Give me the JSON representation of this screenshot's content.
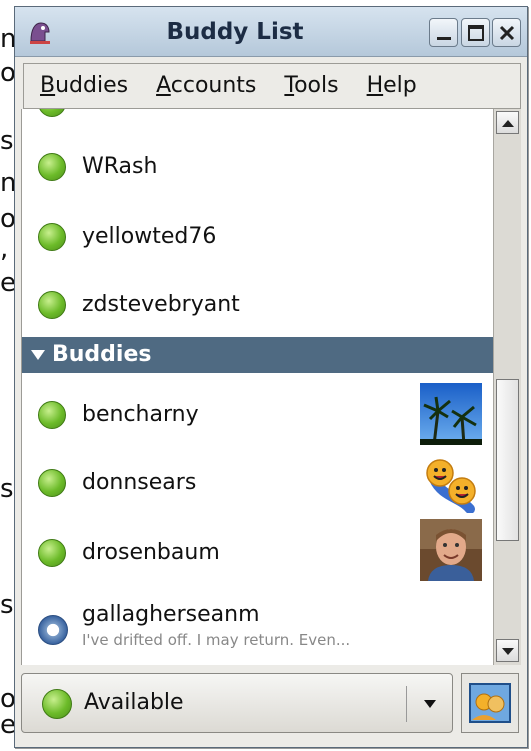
{
  "background_fragments": [
    "n",
    "o",
    "s",
    "n",
    "o",
    ",",
    "e",
    "s",
    "s",
    "o",
    "e"
  ],
  "window": {
    "title": "Buddy List"
  },
  "menu": [
    {
      "key": "B",
      "rest": "uddies"
    },
    {
      "key": "A",
      "rest": "ccounts"
    },
    {
      "key": "T",
      "rest": "ools"
    },
    {
      "key": "H",
      "rest": "elp"
    }
  ],
  "buddies_top": [
    {
      "name": "WRash",
      "status": "available"
    },
    {
      "name": "yellowted76",
      "status": "available"
    },
    {
      "name": "zdstevebryant",
      "status": "available"
    }
  ],
  "group": {
    "label": "Buddies"
  },
  "buddies_group": [
    {
      "name": "bencharny",
      "status": "available",
      "avatar": "palm-trees-avatar"
    },
    {
      "name": "donnsears",
      "status": "available",
      "avatar": "smiley-faces-avatar"
    },
    {
      "name": "drosenbaum",
      "status": "available",
      "avatar": "photo-avatar"
    },
    {
      "name": "gallagherseanm",
      "status": "away",
      "message": "I've drifted off.  I may return. Even..."
    }
  ],
  "status_selector": {
    "label": "Available"
  },
  "colors": {
    "available": "#6cbb29",
    "group_header": "#4f6a82",
    "titlebar": "#c6d6e6"
  }
}
